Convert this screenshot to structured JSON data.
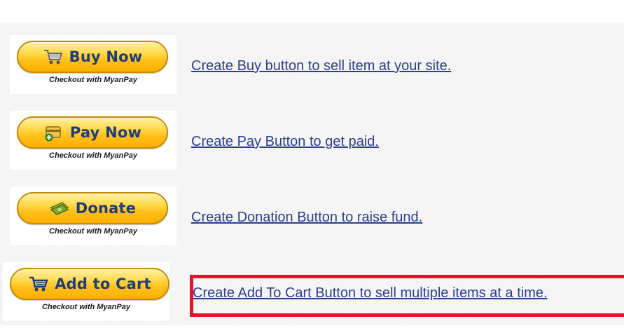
{
  "rows": [
    {
      "button_label": "Buy Now",
      "icon": "shopping-cart-icon",
      "caption": "Checkout with MyanPay",
      "link_text": "Create Buy button to sell item at your site."
    },
    {
      "button_label": "Pay Now",
      "icon": "payment-card-icon",
      "caption": "Checkout with MyanPay",
      "link_text": "Create Pay Button to get paid."
    },
    {
      "button_label": "Donate",
      "icon": "cash-icon",
      "caption": "Checkout with MyanPay",
      "link_text": "Create Donation Button to raise fund."
    },
    {
      "button_label": "Add to Cart",
      "icon": "add-to-cart-icon",
      "caption": "Checkout with MyanPay",
      "link_text": "Create Add To Cart Button to sell multiple items at a time."
    }
  ],
  "colors": {
    "button_text": "#1f3d7a",
    "button_fill": "#ffc21a",
    "link": "#2b3f8f",
    "highlight_border": "#e8112d"
  }
}
